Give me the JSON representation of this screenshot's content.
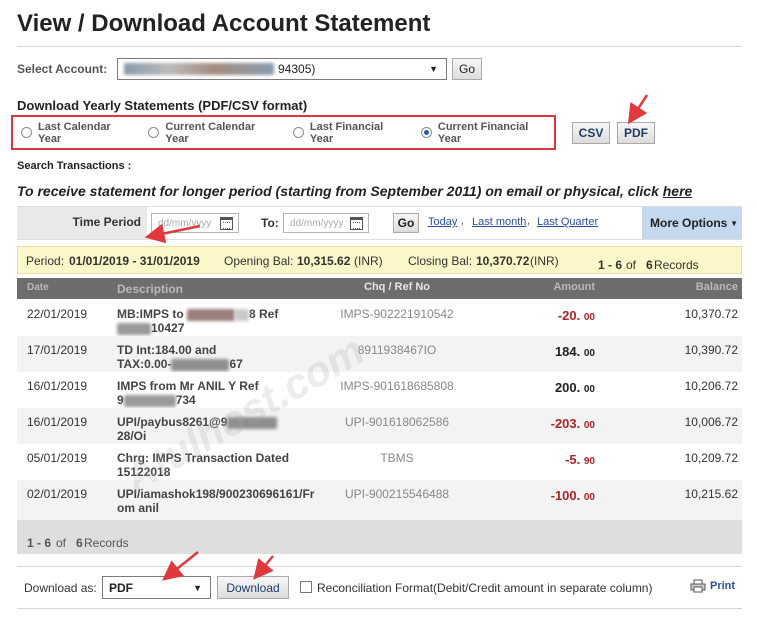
{
  "page": {
    "title": "View / Download Account Statement"
  },
  "account": {
    "label": "Select Account:",
    "value_suffix": "94305)",
    "go": "Go"
  },
  "yearly": {
    "heading": "Download Yearly Statements (PDF/CSV format)",
    "options": [
      "Last Calendar Year",
      "Current Calendar Year",
      "Last Financial Year",
      "Current Financial Year"
    ],
    "selected": "Current Financial Year",
    "csv": "CSV",
    "pdf": "PDF"
  },
  "search": {
    "label": "Search Transactions :",
    "notice": "To receive statement for longer period (starting from September 2011) on email or physical, click",
    "notice_link": "here"
  },
  "period_bar": {
    "time_period": "Time Period",
    "from_placeholder": "dd/mm/yyyy",
    "to_label": "To:",
    "to_placeholder": "dd/mm/yyyy",
    "go": "Go",
    "links": [
      "Today",
      "Last month",
      "Last Quarter"
    ],
    "more_options": "More Options"
  },
  "summary": {
    "period_label": "Period:",
    "period_value": "01/01/2019 - 31/01/2019",
    "opening_label": "Opening Bal:",
    "opening_value": "10,315.62",
    "opening_unit": "(INR)",
    "closing_label": "Closing Bal:",
    "closing_value": "10,370.72",
    "closing_unit": "(INR)",
    "range": "1 - 6",
    "of": "of",
    "count": "6",
    "records": "Records"
  },
  "table": {
    "headers": [
      "Date",
      "Description",
      "Chq / Ref No",
      "Amount",
      "Balance"
    ],
    "rows": [
      {
        "date": "22/01/2019",
        "desc1": "MB:IMPS to",
        "desc1b": "8 Ref",
        "desc2": "10427",
        "ref": "IMPS-902221910542",
        "amt": "-20.",
        "dec": "00",
        "neg": true,
        "bal": "10,370.72"
      },
      {
        "date": "17/01/2019",
        "desc1": "TD Int:184.00 and",
        "desc1b": "",
        "desc2": "TAX:0.00-",
        "desc2b": "67",
        "ref": "8911938467IO",
        "amt": "184.",
        "dec": "00",
        "neg": false,
        "bal": "10,390.72"
      },
      {
        "date": "16/01/2019",
        "desc1": "IMPS from Mr ANIL Y Ref",
        "desc1b": "",
        "desc2": "9",
        "desc2b": "734",
        "ref": "IMPS-901618685808",
        "amt": "200.",
        "dec": "00",
        "neg": false,
        "bal": "10,206.72"
      },
      {
        "date": "16/01/2019",
        "desc1": "UPI/paybus8261@9",
        "desc1b": "28/Oi",
        "desc2": "d70863059",
        "ref": "UPI-901618062586",
        "amt": "-203.",
        "dec": "00",
        "neg": true,
        "bal": "10,006.72"
      },
      {
        "date": "05/01/2019",
        "desc1": "Chrg: IMPS Transaction Dated",
        "desc1b": "",
        "desc2": "15122018",
        "ref": "TBMS",
        "amt": "-5.",
        "dec": "90",
        "neg": true,
        "bal": "10,209.72"
      },
      {
        "date": "02/01/2019",
        "desc1": "UPI/iamashok198/900230696161/Fr",
        "desc1b": "",
        "desc2": "om anil",
        "ref": "UPI-900215546488",
        "amt": "-100.",
        "dec": "00",
        "neg": true,
        "bal": "10,215.62"
      }
    ]
  },
  "footer_count": {
    "range": "1 - 6",
    "of": "of",
    "count": "6",
    "records": "Records"
  },
  "download": {
    "label": "Download as:",
    "format": "PDF",
    "button": "Download",
    "reconciliation": "Reconciliation Format(Debit/Credit amount in separate column)",
    "print": "Print"
  },
  "watermark": "Atulhost.com",
  "colors": {
    "accent_red": "#d9363e",
    "negative": "#b0222a",
    "header_gray": "#6d6d6d",
    "summary_yellow": "#fbf7c8",
    "more_options_blue": "#c4d8f0"
  }
}
